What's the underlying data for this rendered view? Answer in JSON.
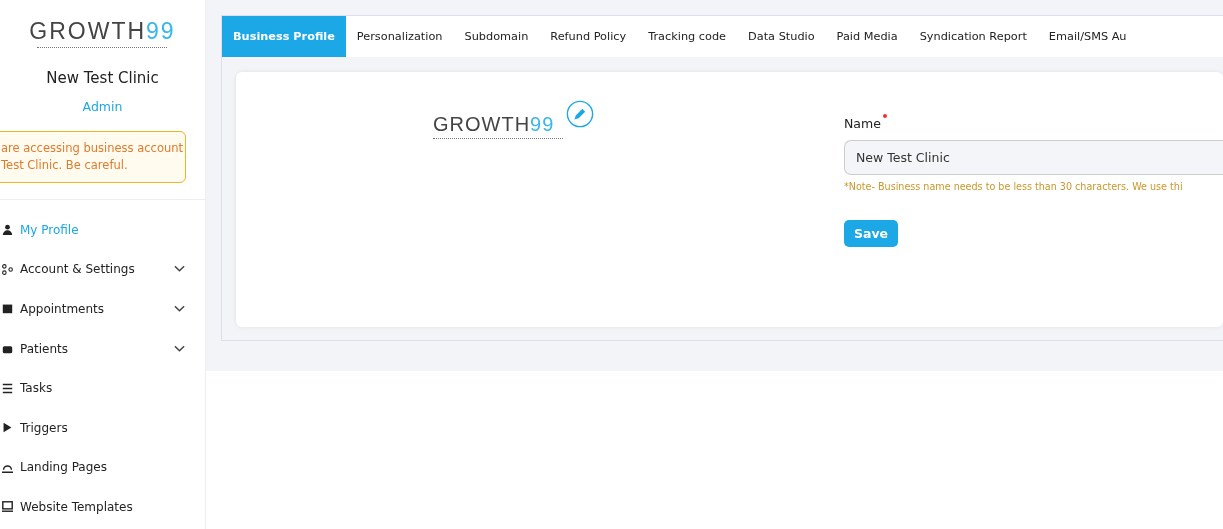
{
  "sidebar": {
    "logo": "GROWTH99",
    "business_name": "New Test Clinic",
    "role": "Admin",
    "warning_lines": [
      "are accessing business account",
      "Test Clinic. Be careful."
    ],
    "items": [
      {
        "label": "My Profile",
        "selected": true,
        "expandable": false
      },
      {
        "label": "Account & Settings",
        "selected": false,
        "expandable": true
      },
      {
        "label": "Appointments",
        "selected": false,
        "expandable": true
      },
      {
        "label": "Patients",
        "selected": false,
        "expandable": true
      },
      {
        "label": "Tasks",
        "selected": false,
        "expandable": false
      },
      {
        "label": "Triggers",
        "selected": false,
        "expandable": false
      },
      {
        "label": "Landing Pages",
        "selected": false,
        "expandable": false
      },
      {
        "label": "Website Templates",
        "selected": false,
        "expandable": false
      }
    ]
  },
  "tabs": [
    {
      "label": "Business Profile",
      "selected": true
    },
    {
      "label": "Personalization",
      "selected": false
    },
    {
      "label": "Subdomain",
      "selected": false
    },
    {
      "label": "Refund Policy",
      "selected": false
    },
    {
      "label": "Tracking code",
      "selected": false
    },
    {
      "label": "Data Studio",
      "selected": false
    },
    {
      "label": "Paid Media",
      "selected": false
    },
    {
      "label": "Syndication Report",
      "selected": false
    },
    {
      "label": "Email/SMS Au",
      "selected": false
    }
  ],
  "profile": {
    "logo": "GROWTH99",
    "name_label": "Name",
    "required": true,
    "name_value": "New Test Clinic",
    "note": "*Note- Business name needs to be less than 30 characters. We use thi",
    "save_button": "Save"
  }
}
